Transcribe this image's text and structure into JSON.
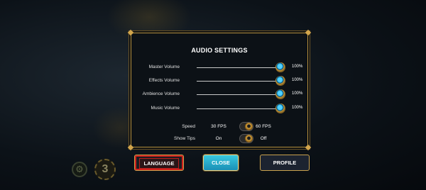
{
  "panel": {
    "title": "AUDIO SETTINGS",
    "sliders": [
      {
        "label": "Master Volume",
        "value": "100%",
        "level": 1.0
      },
      {
        "label": "Effects Volume",
        "value": "100%",
        "level": 1.0
      },
      {
        "label": "Ambience Volume",
        "value": "100%",
        "level": 1.0
      },
      {
        "label": "Music Volume",
        "value": "100%",
        "level": 1.0
      }
    ],
    "toggles": [
      {
        "label": "Speed",
        "left_option": "30 FPS",
        "right_option": "60 FPS",
        "selected": "right"
      },
      {
        "label": "Show Tips",
        "left_option": "On",
        "right_option": "Off",
        "selected": "right"
      }
    ]
  },
  "buttons": {
    "language": "LANGUAGE",
    "close": "CLOSE",
    "profile": "PROFILE"
  },
  "hud": {
    "badge_number": "3",
    "gear_icon": "gear-icon"
  },
  "colors": {
    "accent_gold": "#c9a24e",
    "close_cyan": "#38c9e0",
    "language_red": "#d2201c",
    "knob_blue": "#4fd2ff"
  }
}
